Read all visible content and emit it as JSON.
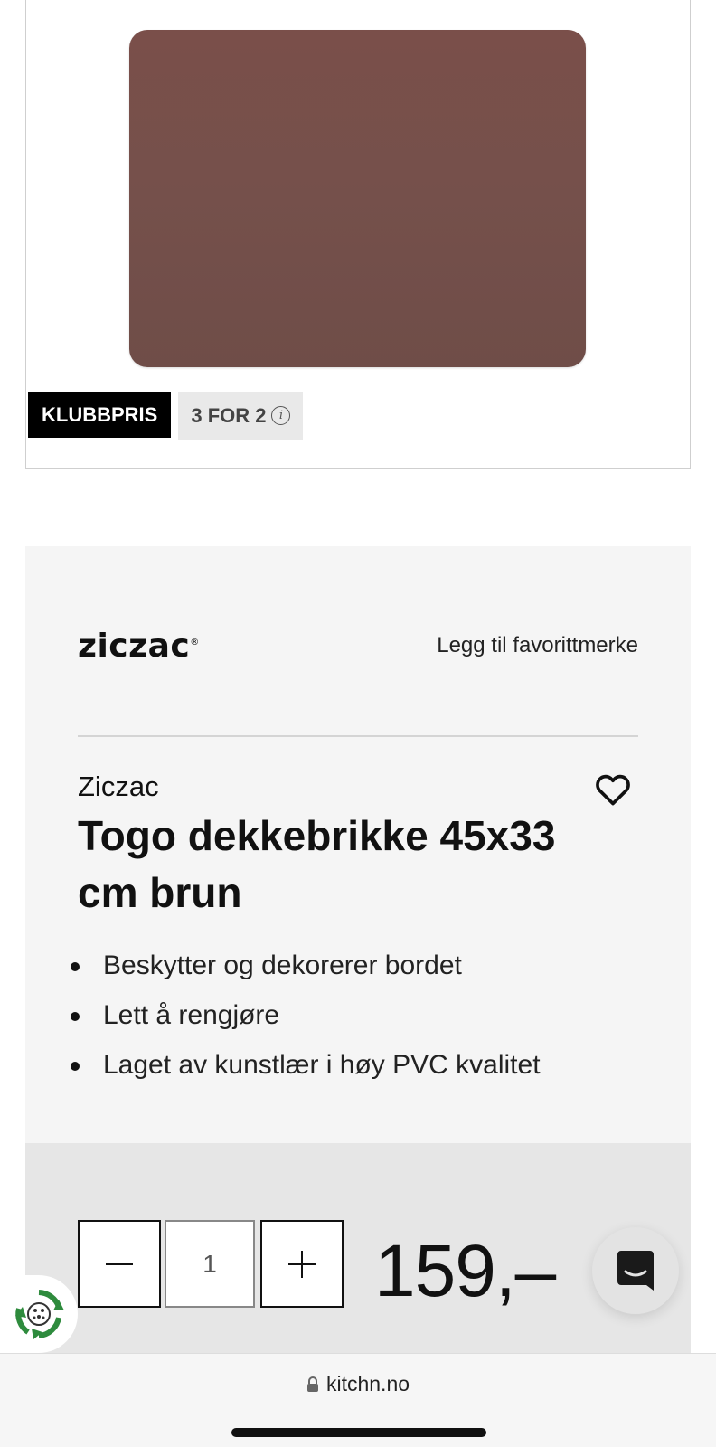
{
  "badges": {
    "club_price": "KLUBBPRIS",
    "deal": "3 FOR 2",
    "info_glyph": "i"
  },
  "brand": {
    "logo_text": "ziczac",
    "logo_mark": "®",
    "favorite_brand_link": "Legg til favorittmerke"
  },
  "product": {
    "brand_name": "Ziczac",
    "title": "Togo dekkebrikke 45x33 cm brun",
    "image_color": "#75504b",
    "features": [
      "Beskytter og dekorerer bordet",
      "Lett å rengjøre",
      "Laget av kunstlær i høy PVC kvalitet"
    ]
  },
  "purchase": {
    "quantity": "1",
    "price": "159,–"
  },
  "browser": {
    "url": "kitchn.no"
  },
  "icons": {
    "heart": "heart-icon",
    "minus": "minus-icon",
    "plus": "plus-icon",
    "chat": "chat-icon",
    "recycle": "recycle-icon",
    "lock": "lock-icon"
  }
}
